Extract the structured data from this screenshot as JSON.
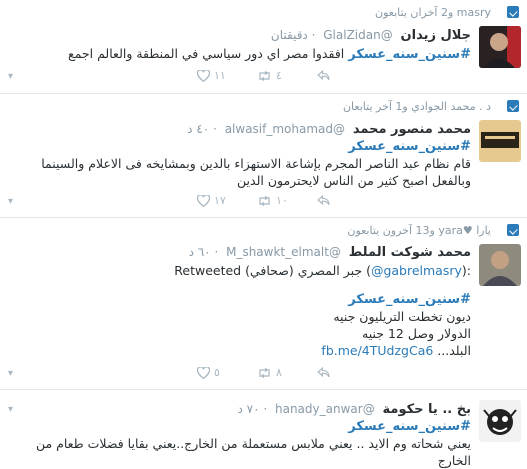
{
  "tweets": [
    {
      "context": "masry و2 آخران يتابعون",
      "name": "جلال زيدان",
      "handle": "@GlalZidan",
      "time": "· دقيقتان",
      "hashtag": "#سنين_سنه_عسكر",
      "text": "افقدوا مصر اي دور سياسي في المنطقة والعالم اجمع",
      "counts": {
        "retweets": "٤",
        "likes": "١١"
      }
    },
    {
      "context": "د . محمد الجوادي و1 آخر يتابعان",
      "name": "محمد منصور محمد",
      "handle": "@alwasif_mohamad",
      "time": "· ٤٠ د",
      "hashtag": "#سنين_سنه_عسكر",
      "text": "قام نظام عبد الناصر المجرم بإشاعة الاستهزاء بالدين وبمشايخه فى الاعلام والسينما وبالفعل اصبح كثير من الناس لايحترمون الدين",
      "counts": {
        "retweets": "١٠",
        "likes": "١٧"
      }
    },
    {
      "context": "يارا ♥yara و13 آخرون يتابعون",
      "name": "محمد شوكت الملط",
      "handle": "@M_shawkt_elmalt",
      "time": "· ٦٠ د",
      "retweeted_prefix": "Retweeted جبر المصري (صحافي) (",
      "retweeted_handle": "@gabrelmasry",
      "retweeted_suffix": "):",
      "hashtag": "#سنين_سنه_عسكر",
      "lines": [
        "ديون تخطت التريليون جنيه",
        "الدولار وصل 12 جنيه",
        "البلد..."
      ],
      "link": "fb.me/4TUdzgCa6",
      "counts": {
        "retweets": "٨",
        "likes": "٥"
      }
    },
    {
      "name": "بخ .. يا حكومة",
      "handle": "@hanady_anwar",
      "time": "· ٧٠ د",
      "hashtag": "#سنين_سنه_عسكر",
      "text": "يعني شحاته وم الايد .. يعني ملابس مستعملة من الخارج..يعني بقايا فضلات طعام من الخارج"
    }
  ],
  "colors": {
    "accent": "#2b7bb9",
    "muted": "#8899a6",
    "icon": "#aab8c2",
    "like": "#e0245e"
  }
}
